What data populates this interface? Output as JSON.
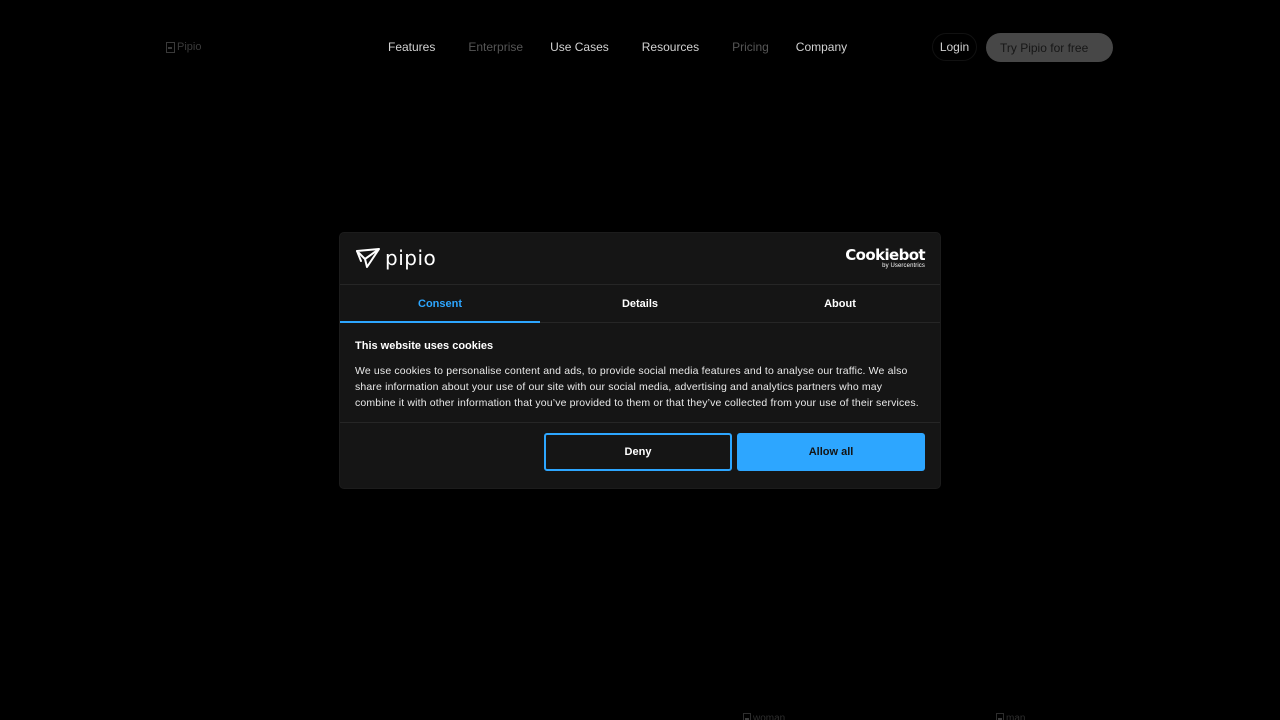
{
  "nav": {
    "logo_alt": "Pipio",
    "links": [
      {
        "label": "Features",
        "dim": false
      },
      {
        "label": "Enterprise",
        "dim": true
      },
      {
        "label": "Use Cases",
        "dim": false
      },
      {
        "label": "Resources",
        "dim": false
      },
      {
        "label": "Pricing",
        "dim": true
      },
      {
        "label": "Company",
        "dim": false
      }
    ],
    "login_label": "Login",
    "cta_label": "Try Pipio for free"
  },
  "bottom_images": {
    "left_alt": "woman",
    "right_alt": "man"
  },
  "dialog": {
    "brand_name": "pipio",
    "cookiebot": {
      "name": "Cookiebot",
      "sub": "by Usercentrics"
    },
    "tabs": [
      {
        "label": "Consent",
        "active": true
      },
      {
        "label": "Details",
        "active": false
      },
      {
        "label": "About",
        "active": false
      }
    ],
    "title": "This website uses cookies",
    "text": "We use cookies to personalise content and ads, to provide social media features and to analyse our traffic. We also share information about your use of our site with our social media, advertising and analytics partners who may combine it with other information that you’ve provided to them or that they’ve collected from your use of their services.",
    "deny_label": "Deny",
    "allow_label": "Allow all"
  },
  "colors": {
    "accent": "#2da6ff",
    "dialog_bg": "#151515",
    "page_bg": "#000000"
  }
}
